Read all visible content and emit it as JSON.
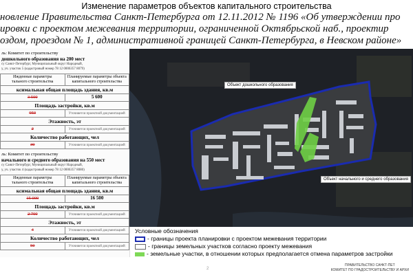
{
  "title": "Изменение параметров объектов капитального строительства",
  "subtitle_lines": [
    "новление Правительства Санкт-Петербурга от 12.11.2012 № 1196 «Об утверждении про",
    "ировки с проектом межевания территории, ограниченной Октябрьской наб., проектир",
    "оздом, проездом № 1, административной границей Санкт-Петербурга, в Невском районе»"
  ],
  "sections": [
    {
      "customer": "ль: Комитет по строительству",
      "object": "дошкольного образования на 200 мест",
      "address1": "су  Санкт-Петербург,  Муниципальный  округ  Народный,",
      "address2": "у, уч. участок 5 (кадастровый номер 78 12 0006357 8079)",
      "head_left": "Ижденные параметры",
      "head_left2": "тального строительства",
      "head_right": "Планируемые параметры объекта",
      "head_right2": "капитального строительства",
      "rows": [
        {
          "label": "ксимальная общая площадь здания, кв.м",
          "old": "3 500",
          "new": "5 600"
        },
        {
          "label": "Площадь застройки, кв.м",
          "old": "950",
          "new": "Уточняется проектной документацией"
        },
        {
          "label": "Этажность, эт",
          "old": "2",
          "new": "Уточняется проектной документацией"
        },
        {
          "label": "Количество работающих, чел",
          "old": "30",
          "new": "Уточняется проектной документацией"
        }
      ]
    },
    {
      "customer": "ль: Комитет по строительству",
      "object": "начального и среднего образования на 550 мест",
      "address1": "су  Санкт-Петербург,  Муниципальный  округ  Народный,",
      "address2": "у, уч. участок 4 (кадастровый номер 78 12 0006357 8080)",
      "head_left": "Ижденные параметры",
      "head_left2": "тального строительства",
      "head_right": "Планируемые параметры объекта",
      "head_right2": "капитального строительства",
      "rows": [
        {
          "label": "ксимальная общая площадь здания, кв.м",
          "old": "15 000",
          "new": "16 500"
        },
        {
          "label": "Площадь застройки, кв.м",
          "old": "2 700",
          "new": "Уточняется проектной документацией"
        },
        {
          "label": "Этажность, эт",
          "old": "4",
          "new": "Уточняется проектной документацией"
        },
        {
          "label": "Количество работающих, чел",
          "old": "50",
          "new": "Уточняется проектной документацией"
        }
      ]
    }
  ],
  "map": {
    "callout_preschool": "Объект дошкольного образования",
    "callout_school": "Объект начального и среднего образования"
  },
  "legend": {
    "title": "Условные обозначения",
    "items": [
      {
        "text": "- границы проекта планировки с проектом межевания территории",
        "color": "#1a2bb0"
      },
      {
        "text": "- границы земельных участков согласно проекту межевания",
        "color": "#ffffff"
      },
      {
        "text": "- земельные участки, в отношении которых предполагается отмена параметров застройки",
        "color": "#7ed957"
      }
    ]
  },
  "footer": {
    "line1": "ПРАВИТЕЛЬСТВО САНКТ-ПЕТ",
    "line2": "КОМИТЕТ ПО ГРАДОСТРОИТЕЛЬСТВУ И АРХИ"
  },
  "page_number": "2"
}
